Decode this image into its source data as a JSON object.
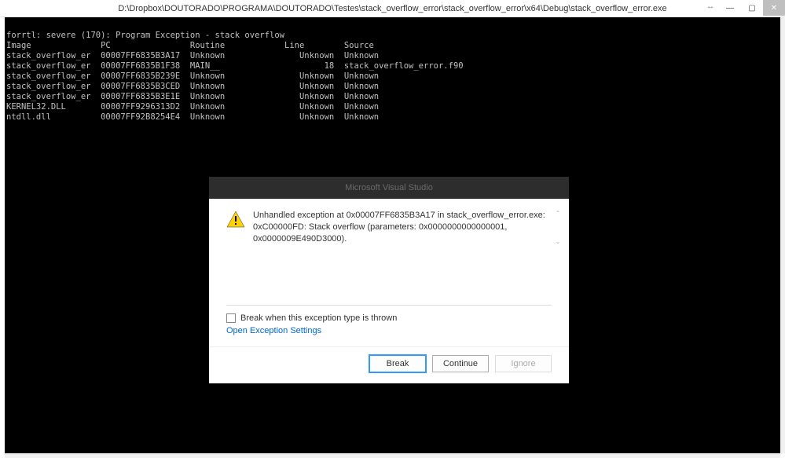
{
  "titlebar": {
    "title": "D:\\Dropbox\\DOUTORADO\\PROGRAMA\\DOUTORADO\\Testes\\stack_overflow_error\\stack_overflow_error\\x64\\Debug\\stack_overflow_error.exe"
  },
  "console": {
    "header_line": "forrtl: severe (170): Program Exception - stack overflow",
    "columns": "Image              PC                Routine            Line        Source",
    "rows": [
      "stack_overflow_er  00007FF6835B3A17  Unknown               Unknown  Unknown",
      "stack_overflow_er  00007FF6835B1F38  MAIN__                     18  stack_overflow_error.f90",
      "stack_overflow_er  00007FF6835B239E  Unknown               Unknown  Unknown",
      "stack_overflow_er  00007FF6835B3CED  Unknown               Unknown  Unknown",
      "stack_overflow_er  00007FF6835B3E1E  Unknown               Unknown  Unknown",
      "KERNEL32.DLL       00007FF9296313D2  Unknown               Unknown  Unknown",
      "ntdll.dll          00007FF92B8254E4  Unknown               Unknown  Unknown"
    ]
  },
  "dialog": {
    "title": "Microsoft Visual Studio",
    "message_line1": "Unhandled exception at 0x00007FF6835B3A17 in stack_overflow_error.exe:",
    "message_line2": "0xC00000FD: Stack overflow (parameters: 0x0000000000000001, 0x0000009E490D3000).",
    "checkbox_label": "Break when this exception type is thrown",
    "link_label": "Open Exception Settings",
    "buttons": {
      "break": "Break",
      "continue": "Continue",
      "ignore": "Ignore"
    }
  }
}
